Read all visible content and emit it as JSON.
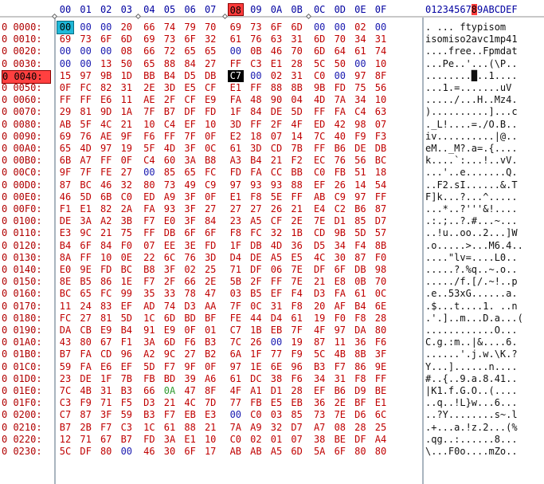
{
  "header": {
    "hex_columns": [
      "00",
      "01",
      "02",
      "03",
      "04",
      "05",
      "06",
      "07",
      "08",
      "09",
      "0A",
      "0B",
      "0C",
      "0D",
      "0E",
      "0F"
    ],
    "selected_column": "08",
    "ascii_header_left": "01234567",
    "ascii_header_sel": "8",
    "ascii_header_right": "9ABCDEF"
  },
  "rows": [
    {
      "offset": "0 0000:",
      "bytes": [
        "00",
        "00",
        "00",
        "20",
        "66",
        "74",
        "79",
        "70",
        "69",
        "73",
        "6F",
        "6D",
        "00",
        "00",
        "02",
        "00"
      ],
      "ascii": ". ... ftypisom",
      "sel": false
    },
    {
      "offset": "0 0010:",
      "bytes": [
        "69",
        "73",
        "6F",
        "6D",
        "69",
        "73",
        "6F",
        "32",
        "61",
        "76",
        "63",
        "31",
        "6D",
        "70",
        "34",
        "31"
      ],
      "ascii": "isomiso2avc1mp41",
      "sel": false
    },
    {
      "offset": "0 0020:",
      "bytes": [
        "00",
        "00",
        "00",
        "08",
        "66",
        "72",
        "65",
        "65",
        "00",
        "0B",
        "46",
        "70",
        "6D",
        "64",
        "61",
        "74"
      ],
      "ascii": "....free..Fpmdat",
      "sel": false
    },
    {
      "offset": "0 0030:",
      "bytes": [
        "00",
        "00",
        "13",
        "50",
        "65",
        "88",
        "84",
        "27",
        "FF",
        "C3",
        "E1",
        "28",
        "5C",
        "50",
        "00",
        "10"
      ],
      "ascii": "...Pe..'...(\\P..",
      "sel": false
    },
    {
      "offset": "0 0040:",
      "bytes": [
        "15",
        "97",
        "9B",
        "1D",
        "BB",
        "B4",
        "D5",
        "DB",
        "C7",
        "00",
        "02",
        "31",
        "C0",
        "00",
        "97",
        "8F"
      ],
      "ascii": "........█..1....",
      "sel": true
    },
    {
      "offset": "0 0050:",
      "bytes": [
        "0F",
        "FC",
        "82",
        "31",
        "2E",
        "3D",
        "E5",
        "CF",
        "E1",
        "FF",
        "88",
        "8B",
        "9B",
        "FD",
        "75",
        "56"
      ],
      "ascii": "...1.=.......uV",
      "sel": false
    },
    {
      "offset": "0 0060:",
      "bytes": [
        "FF",
        "FF",
        "E6",
        "11",
        "AE",
        "2F",
        "CF",
        "E9",
        "FA",
        "48",
        "90",
        "04",
        "4D",
        "7A",
        "34",
        "10"
      ],
      "ascii": "...../...H..Mz4.",
      "sel": false
    },
    {
      "offset": "0 0070:",
      "bytes": [
        "29",
        "81",
        "9D",
        "1A",
        "7F",
        "B7",
        "DF",
        "FD",
        "1F",
        "84",
        "DE",
        "5D",
        "FF",
        "FA",
        "C4",
        "63"
      ],
      "ascii": ")..........]...c",
      "sel": false
    },
    {
      "offset": "0 0080:",
      "bytes": [
        "AB",
        "5F",
        "4C",
        "21",
        "10",
        "C4",
        "EF",
        "10",
        "3D",
        "FF",
        "2F",
        "4F",
        "ED",
        "42",
        "98",
        "07"
      ],
      "ascii": "._L!....=./O.B..",
      "sel": false
    },
    {
      "offset": "0 0090:",
      "bytes": [
        "69",
        "76",
        "AE",
        "9F",
        "F6",
        "FF",
        "7F",
        "0F",
        "E2",
        "18",
        "07",
        "14",
        "7C",
        "40",
        "F9",
        "F3"
      ],
      "ascii": "iv..........|@..",
      "sel": false
    },
    {
      "offset": "0 00A0:",
      "bytes": [
        "65",
        "4D",
        "97",
        "19",
        "5F",
        "4D",
        "3F",
        "0C",
        "61",
        "3D",
        "CD",
        "7B",
        "FF",
        "B6",
        "DE",
        "DB"
      ],
      "ascii": "eM.._M?.a=.{....",
      "sel": false
    },
    {
      "offset": "0 00B0:",
      "bytes": [
        "6B",
        "A7",
        "FF",
        "0F",
        "C4",
        "60",
        "3A",
        "B8",
        "A3",
        "B4",
        "21",
        "F2",
        "EC",
        "76",
        "56",
        "BC"
      ],
      "ascii": "k....`:...!..vV.",
      "sel": false
    },
    {
      "offset": "0 00C0:",
      "bytes": [
        "9F",
        "7F",
        "FE",
        "27",
        "00",
        "85",
        "65",
        "FC",
        "FD",
        "FA",
        "CC",
        "BB",
        "C0",
        "FB",
        "51",
        "18"
      ],
      "ascii": "...'..e.......Q.",
      "sel": false
    },
    {
      "offset": "0 00D0:",
      "bytes": [
        "87",
        "BC",
        "46",
        "32",
        "80",
        "73",
        "49",
        "C9",
        "97",
        "93",
        "93",
        "88",
        "EF",
        "26",
        "14",
        "54"
      ],
      "ascii": "..F2.sI......&.T",
      "sel": false
    },
    {
      "offset": "0 00E0:",
      "bytes": [
        "46",
        "5D",
        "6B",
        "C0",
        "ED",
        "A9",
        "3F",
        "0F",
        "E1",
        "F8",
        "5E",
        "FF",
        "AB",
        "C9",
        "97",
        "FF"
      ],
      "ascii": "F]k...?...^.....",
      "sel": false
    },
    {
      "offset": "0 00F0:",
      "bytes": [
        "F1",
        "E1",
        "82",
        "2A",
        "FA",
        "93",
        "3F",
        "27",
        "27",
        "27",
        "26",
        "21",
        "E4",
        "C2",
        "B6",
        "87"
      ],
      "ascii": "...*..?'''&!....",
      "sel": false
    },
    {
      "offset": "0 0100:",
      "bytes": [
        "DE",
        "3A",
        "A2",
        "3B",
        "F7",
        "E0",
        "3F",
        "84",
        "23",
        "A5",
        "CF",
        "2E",
        "7E",
        "D1",
        "85",
        "D7"
      ],
      "ascii": ".:.;..?.#...~...",
      "sel": false
    },
    {
      "offset": "0 0110:",
      "bytes": [
        "E3",
        "9C",
        "21",
        "75",
        "FF",
        "DB",
        "6F",
        "6F",
        "F8",
        "FC",
        "32",
        "1B",
        "CD",
        "9B",
        "5D",
        "57"
      ],
      "ascii": "..!u..oo..2...]W",
      "sel": false
    },
    {
      "offset": "0 0120:",
      "bytes": [
        "B4",
        "6F",
        "84",
        "F0",
        "07",
        "EE",
        "3E",
        "FD",
        "1F",
        "DB",
        "4D",
        "36",
        "D5",
        "34",
        "F4",
        "8B"
      ],
      "ascii": ".o.....>...M6.4..",
      "sel": false
    },
    {
      "offset": "0 0130:",
      "bytes": [
        "8A",
        "FF",
        "10",
        "0E",
        "22",
        "6C",
        "76",
        "3D",
        "D4",
        "DE",
        "A5",
        "E5",
        "4C",
        "30",
        "87",
        "F0"
      ],
      "ascii": "....\"lv=....L0..",
      "sel": false
    },
    {
      "offset": "0 0140:",
      "bytes": [
        "E0",
        "9E",
        "FD",
        "BC",
        "B8",
        "3F",
        "02",
        "25",
        "71",
        "DF",
        "06",
        "7E",
        "DF",
        "6F",
        "DB",
        "98"
      ],
      "ascii": ".....?.%q..~.o..",
      "sel": false
    },
    {
      "offset": "0 0150:",
      "bytes": [
        "8E",
        "B5",
        "86",
        "1E",
        "F7",
        "2F",
        "66",
        "2E",
        "5B",
        "2F",
        "FF",
        "7E",
        "21",
        "E8",
        "0B",
        "70"
      ],
      "ascii": "...../f.[/.~!..p",
      "sel": false
    },
    {
      "offset": "0 0160:",
      "bytes": [
        "BC",
        "65",
        "FC",
        "99",
        "35",
        "33",
        "78",
        "47",
        "03",
        "B5",
        "EF",
        "F4",
        "D3",
        "FA",
        "61",
        "0C"
      ],
      "ascii": ".e..53xG......a.",
      "sel": false
    },
    {
      "offset": "0 0170:",
      "bytes": [
        "11",
        "24",
        "83",
        "EF",
        "AD",
        "74",
        "D3",
        "AA",
        "7F",
        "0C",
        "31",
        "F8",
        "20",
        "AF",
        "B4",
        "6E"
      ],
      "ascii": ".$...t....1. ..n",
      "sel": false
    },
    {
      "offset": "0 0180:",
      "bytes": [
        "FC",
        "27",
        "81",
        "5D",
        "1C",
        "6D",
        "BD",
        "BF",
        "FE",
        "44",
        "D4",
        "61",
        "19",
        "F0",
        "F8",
        "28"
      ],
      "ascii": ".'.]..m...D.a...(",
      "sel": false
    },
    {
      "offset": "0 0190:",
      "bytes": [
        "DA",
        "CB",
        "E9",
        "B4",
        "91",
        "E9",
        "0F",
        "01",
        "C7",
        "1B",
        "EB",
        "7F",
        "4F",
        "97",
        "DA",
        "80"
      ],
      "ascii": "............O...",
      "sel": false
    },
    {
      "offset": "0 01A0:",
      "bytes": [
        "43",
        "80",
        "67",
        "F1",
        "3A",
        "6D",
        "F6",
        "B3",
        "7C",
        "26",
        "00",
        "19",
        "87",
        "11",
        "36",
        "F6"
      ],
      "ascii": "C.g.:m..|&....6.",
      "sel": false
    },
    {
      "offset": "0 01B0:",
      "bytes": [
        "B7",
        "FA",
        "CD",
        "96",
        "A2",
        "9C",
        "27",
        "B2",
        "6A",
        "1F",
        "77",
        "F9",
        "5C",
        "4B",
        "8B",
        "3F"
      ],
      "ascii": "......'.j.w.\\K.?",
      "sel": false
    },
    {
      "offset": "0 01C0:",
      "bytes": [
        "59",
        "FA",
        "E6",
        "EF",
        "5D",
        "F7",
        "9F",
        "0F",
        "97",
        "1E",
        "6E",
        "96",
        "B3",
        "F7",
        "86",
        "9E"
      ],
      "ascii": "Y...]......n....",
      "sel": false
    },
    {
      "offset": "0 01D0:",
      "bytes": [
        "23",
        "DE",
        "1F",
        "7B",
        "FB",
        "BD",
        "39",
        "A6",
        "61",
        "DC",
        "38",
        "F6",
        "34",
        "31",
        "F8",
        "FF"
      ],
      "ascii": "#..{..9.a.8.41..",
      "sel": false
    },
    {
      "offset": "0 01E0:",
      "bytes": [
        "7C",
        "4B",
        "31",
        "B3",
        "66",
        "0A",
        "47",
        "8F",
        "4F",
        "A1",
        "D1",
        "28",
        "EF",
        "B6",
        "D9",
        "BE"
      ],
      "ascii": "|K1.f.G.O..(....",
      "sel": false
    },
    {
      "offset": "0 01F0:",
      "bytes": [
        "C3",
        "F9",
        "71",
        "F5",
        "D3",
        "21",
        "4C",
        "7D",
        "77",
        "FB",
        "E5",
        "EB",
        "36",
        "2E",
        "BF",
        "E1"
      ],
      "ascii": "..q..!L}w...6...",
      "sel": false
    },
    {
      "offset": "0 0200:",
      "bytes": [
        "C7",
        "87",
        "3F",
        "59",
        "B3",
        "F7",
        "EB",
        "E3",
        "00",
        "C0",
        "03",
        "85",
        "73",
        "7E",
        "D6",
        "6C"
      ],
      "ascii": "..?Y........s~.l",
      "sel": false
    },
    {
      "offset": "0 0210:",
      "bytes": [
        "B7",
        "2B",
        "F7",
        "C3",
        "1C",
        "61",
        "88",
        "21",
        "7A",
        "A9",
        "32",
        "D7",
        "A7",
        "08",
        "28",
        "25"
      ],
      "ascii": ".+...a.!z.2...(%",
      "sel": false
    },
    {
      "offset": "0 0220:",
      "bytes": [
        "12",
        "71",
        "67",
        "B7",
        "FD",
        "3A",
        "E1",
        "10",
        "C0",
        "02",
        "01",
        "07",
        "38",
        "BE",
        "DF",
        "A4"
      ],
      "ascii": ".qg..:......8...",
      "sel": false
    },
    {
      "offset": "0 0230:",
      "bytes": [
        "5C",
        "DF",
        "80",
        "00",
        "46",
        "30",
        "6F",
        "17",
        "AB",
        "AB",
        "A5",
        "6D",
        "5A",
        "6F",
        "80",
        "80"
      ],
      "ascii": "\\...F0o....mZo..",
      "sel": false
    }
  ]
}
